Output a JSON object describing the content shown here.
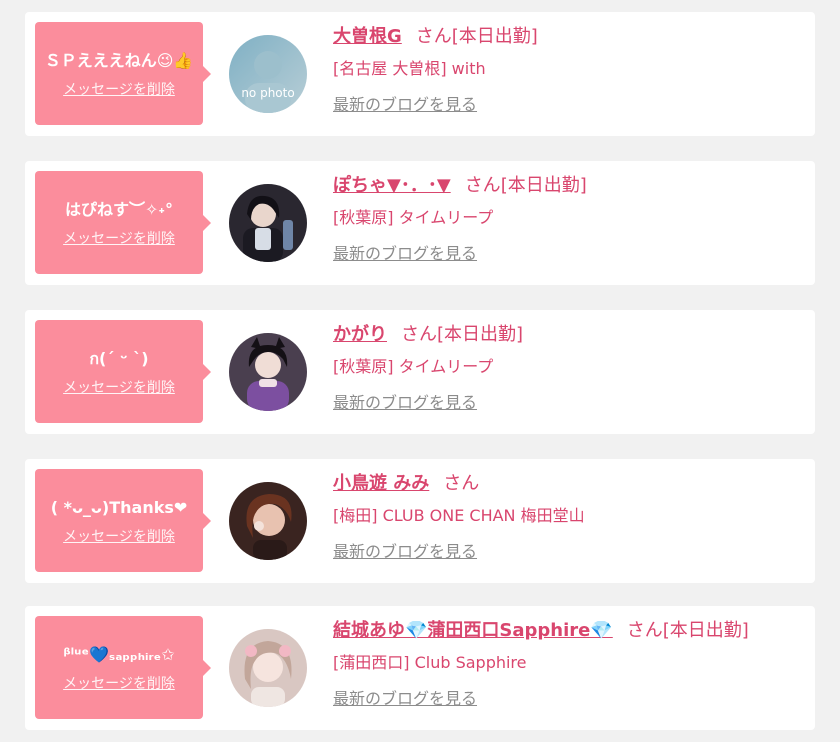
{
  "colors": {
    "accent": "#d9466e",
    "bubble": "#fb8d9c",
    "card": "#ffffff",
    "background": "#f1f1f1",
    "link_gray": "#8c8c8c"
  },
  "items": [
    {
      "message": "ＳＰえええねん😉👍",
      "delete_label": "メッセージを削除",
      "name": "大曽根G",
      "honorific": "さん",
      "status": "[本日出勤]",
      "shop": "[名古屋 大曽根] with",
      "blog_link": "最新のブログを見る",
      "avatar_text": "no photo"
    },
    {
      "message": "はぴねす︶✧˖°",
      "delete_label": "メッセージを削除",
      "name": "ぽちゃ▼･．･▼",
      "honorific": "さん",
      "status": "[本日出勤]",
      "shop": "[秋葉原] タイムリープ",
      "blog_link": "最新のブログを見る"
    },
    {
      "message": "ก(ˊ ᵕ ˋ)",
      "delete_label": "メッセージを削除",
      "name": "かがり",
      "honorific": "さん",
      "status": "[本日出勤]",
      "shop": "[秋葉原] タイムリープ",
      "blog_link": "最新のブログを見る"
    },
    {
      "message": "( *ᴗ_ᴗ)Thanks❤",
      "delete_label": "メッセージを削除",
      "name": "小鳥遊 みみ",
      "honorific": "さん",
      "status": "",
      "shop": "[梅田] CLUB ONE CHAN 梅田堂山",
      "blog_link": "最新のブログを見る"
    },
    {
      "message": "ᵝˡᵘᵉ💙ₛₐₚₚₕᵢᵣₑ✩",
      "delete_label": "メッセージを削除",
      "name": "結城あゆ💎蒲田西口Sapphire💎",
      "honorific": "さん",
      "status": "[本日出勤]",
      "shop": "[蒲田西口] Club Sapphire",
      "blog_link": "最新のブログを見る"
    }
  ]
}
